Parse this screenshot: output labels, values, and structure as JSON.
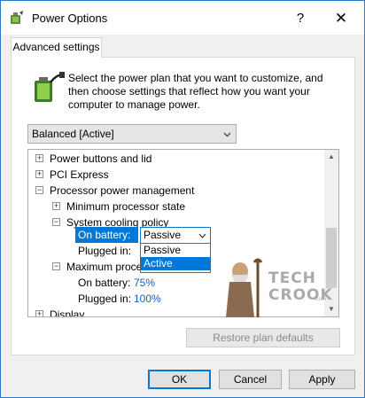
{
  "window": {
    "title": "Power Options",
    "help_label": "?",
    "close_label": "✕",
    "icon": "power-options-icon"
  },
  "tabs": [
    {
      "label": "Advanced settings",
      "active": true
    }
  ],
  "description": "Select the power plan that you want to customize, and then choose settings that reflect how you want your computer to manage power.",
  "plan_select": {
    "value": "Balanced [Active]"
  },
  "tree": {
    "rows": [
      {
        "label": "Power buttons and lid",
        "expander": "+"
      },
      {
        "label": "PCI Express",
        "expander": "+"
      },
      {
        "label": "Processor power management",
        "expander": "−"
      },
      {
        "label": "Minimum processor state",
        "expander": "+"
      },
      {
        "label": "System cooling policy",
        "expander": "−"
      },
      {
        "label": "Plugged in:"
      },
      {
        "label": "Maximum processor state",
        "expander": "−"
      },
      {
        "label": "On battery:",
        "value": "75%"
      },
      {
        "label": "Plugged in:",
        "value": "100%"
      },
      {
        "label": "Display",
        "expander": "+"
      }
    ],
    "on_battery_label": "On battery:",
    "policy_select": {
      "value": "Passive"
    },
    "dropdown_options": [
      {
        "label": "Passive",
        "selected": false
      },
      {
        "label": "Active",
        "selected": true
      }
    ]
  },
  "watermark": {
    "line1": "TECH",
    "line2": "CROOK",
    "suffix": ".com"
  },
  "buttons": {
    "restore": "Restore plan defaults",
    "ok": "OK",
    "cancel": "Cancel",
    "apply": "Apply"
  },
  "colors": {
    "accent": "#0078d7",
    "value_link": "#1a5fb4",
    "window_border": "#2b79c5"
  }
}
